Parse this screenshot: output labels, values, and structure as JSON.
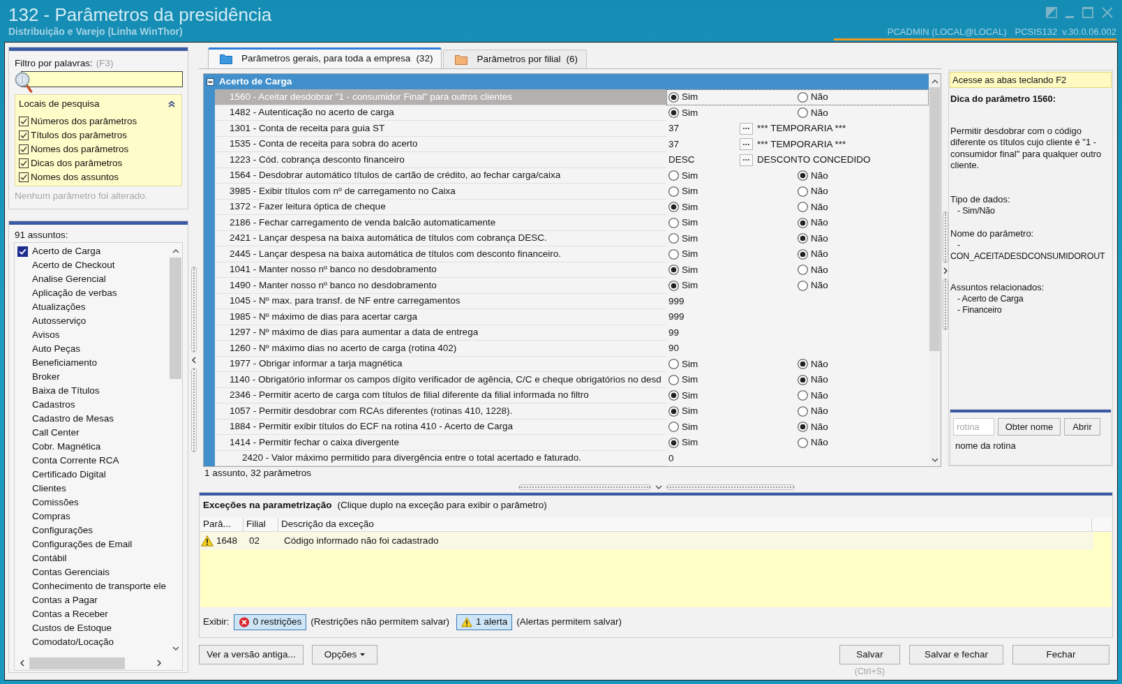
{
  "window": {
    "title": "132 - Parâmetros da presidência",
    "subtitle": "Distribuição e Varejo (Linha WinThor)",
    "session": "PCADMIN (LOCAL@LOCAL)",
    "routine": "PCSIS132",
    "version": "v.30.0.06.002"
  },
  "filter": {
    "label": "Filtro por palavras:",
    "shortcut": "(F3)"
  },
  "search_locations": {
    "title": "Locais de pesquisa",
    "expanded": true,
    "options": [
      {
        "label": "Números dos parâmetros",
        "checked": true
      },
      {
        "label": "Títulos dos parâmetros",
        "checked": true
      },
      {
        "label": "Nomes dos parâmetros",
        "checked": true
      },
      {
        "label": "Dicas dos parâmetros",
        "checked": true
      },
      {
        "label": "Nomes dos assuntos",
        "checked": true
      }
    ]
  },
  "change_status": "Nenhum parâmetro foi alterado.",
  "subjects": {
    "count": "91 assuntos:",
    "items": [
      {
        "label": "Acerto de Carga",
        "checked": true
      },
      {
        "label": "Acerto de Checkout",
        "checked": false
      },
      {
        "label": "Analise Gerencial",
        "checked": false
      },
      {
        "label": "Aplicação de verbas",
        "checked": false
      },
      {
        "label": "Atualizações",
        "checked": false
      },
      {
        "label": "Autosserviço",
        "checked": false
      },
      {
        "label": "Avisos",
        "checked": false
      },
      {
        "label": "Auto Peças",
        "checked": false
      },
      {
        "label": "Beneficiamento",
        "checked": false
      },
      {
        "label": "Broker",
        "checked": false
      },
      {
        "label": "Baixa de Títulos",
        "checked": false
      },
      {
        "label": "Cadastros",
        "checked": false
      },
      {
        "label": "Cadastro de Mesas",
        "checked": false
      },
      {
        "label": "Call Center",
        "checked": false
      },
      {
        "label": "Cobr. Magnética",
        "checked": false
      },
      {
        "label": "Conta Corrente RCA",
        "checked": false
      },
      {
        "label": "Certificado Digital",
        "checked": false
      },
      {
        "label": "Clientes",
        "checked": false
      },
      {
        "label": "Comissões",
        "checked": false
      },
      {
        "label": "Compras",
        "checked": false
      },
      {
        "label": "Configurações",
        "checked": false
      },
      {
        "label": "Configurações de Email",
        "checked": false
      },
      {
        "label": "Contábil",
        "checked": false
      },
      {
        "label": "Contas Gerenciais",
        "checked": false
      },
      {
        "label": "Conhecimento de transporte ele",
        "checked": false
      },
      {
        "label": "Contas a Pagar",
        "checked": false
      },
      {
        "label": "Contas a Receber",
        "checked": false
      },
      {
        "label": "Custos de Estoque",
        "checked": false
      },
      {
        "label": "Comodato/Locação",
        "checked": false
      }
    ]
  },
  "tabs": [
    {
      "label": "Parâmetros gerais, para toda a empresa",
      "count": "(32)",
      "kind": "company",
      "selected": true
    },
    {
      "label": "Parâmetros por filial",
      "count": "(6)",
      "kind": "branch",
      "selected": false
    }
  ],
  "grid": {
    "group": {
      "title": "Acerto de Carga",
      "expanded": true
    },
    "rows": [
      {
        "label": "1560 - Aceitar desdobrar \"1 - consumidor Final\" para outros clientes",
        "kind": "yes_no",
        "selected": true,
        "options": [
          {
            "label": "Sim",
            "selected": true
          },
          {
            "label": "Não",
            "selected": false
          }
        ]
      },
      {
        "label": "1482 - Autenticação no acerto de carga",
        "kind": "yes_no",
        "selected": false,
        "options": [
          {
            "label": "Sim",
            "selected": true
          },
          {
            "label": "Não",
            "selected": false
          }
        ]
      },
      {
        "label": "1301 - Conta de receita para guia ST",
        "kind": "lookup",
        "selected": false,
        "value": "37",
        "description": "*** TEMPORARIA ***"
      },
      {
        "label": "1535 - Conta de receita para sobra do acerto",
        "kind": "lookup",
        "selected": false,
        "value": "37",
        "description": "*** TEMPORARIA ***"
      },
      {
        "label": "1223 - Cód. cobrança desconto financeiro",
        "kind": "lookup",
        "selected": false,
        "value": "DESC",
        "description": "DESCONTO CONCEDIDO"
      },
      {
        "label": "1564 - Desdobrar automático títulos de cartão de crédito, ao fechar carga/caixa",
        "kind": "yes_no",
        "selected": false,
        "options": [
          {
            "label": "Sim",
            "selected": false
          },
          {
            "label": "Não",
            "selected": true
          }
        ]
      },
      {
        "label": "3985 - Exibir títulos com nº de carregamento no Caixa",
        "kind": "yes_no",
        "selected": false,
        "options": [
          {
            "label": "Sim",
            "selected": false
          },
          {
            "label": "Não",
            "selected": false
          }
        ]
      },
      {
        "label": "1372 - Fazer leitura óptica de cheque",
        "kind": "yes_no",
        "selected": false,
        "options": [
          {
            "label": "Sim",
            "selected": true
          },
          {
            "label": "Não",
            "selected": false
          }
        ]
      },
      {
        "label": "2186 - Fechar carregamento de venda balcão automaticamente",
        "kind": "yes_no",
        "selected": false,
        "options": [
          {
            "label": "Sim",
            "selected": false
          },
          {
            "label": "Não",
            "selected": true
          }
        ]
      },
      {
        "label": "2421 - Lançar despesa na baixa automática de títulos com cobrança DESC.",
        "kind": "yes_no",
        "selected": false,
        "options": [
          {
            "label": "Sim",
            "selected": false
          },
          {
            "label": "Não",
            "selected": true
          }
        ]
      },
      {
        "label": "2445 - Lançar despesa na baixa automática de títulos com desconto financeiro.",
        "kind": "yes_no",
        "selected": false,
        "options": [
          {
            "label": "Sim",
            "selected": false
          },
          {
            "label": "Não",
            "selected": true
          }
        ]
      },
      {
        "label": "1041 - Manter nosso nº banco no desdobramento",
        "kind": "yes_no",
        "selected": false,
        "options": [
          {
            "label": "Sim",
            "selected": true
          },
          {
            "label": "Não",
            "selected": false
          }
        ]
      },
      {
        "label": "1490 - Manter nosso nº banco no desdobramento",
        "kind": "yes_no",
        "selected": false,
        "options": [
          {
            "label": "Sim",
            "selected": true
          },
          {
            "label": "Não",
            "selected": false
          }
        ]
      },
      {
        "label": "1045 - Nº max. para transf. de NF entre carregamentos",
        "kind": "number",
        "selected": false,
        "value": "999"
      },
      {
        "label": "1985 - Nº máximo de dias para acertar carga",
        "kind": "number",
        "selected": false,
        "value": "999"
      },
      {
        "label": "1297 - Nº máximo de dias para aumentar a data de entrega",
        "kind": "number",
        "selected": false,
        "value": "99"
      },
      {
        "label": "1260 - Nº máximo dias no acerto de carga (rotina 402)",
        "kind": "number",
        "selected": false,
        "value": "90"
      },
      {
        "label": "1977 - Obrigar informar a tarja magnética",
        "kind": "yes_no",
        "selected": false,
        "options": [
          {
            "label": "Sim",
            "selected": false
          },
          {
            "label": "Não",
            "selected": true
          }
        ]
      },
      {
        "label": "1140 - Obrigatório informar os campos dígito verificador de agência, C/C e cheque obrigatórios no desd",
        "kind": "yes_no",
        "selected": false,
        "options": [
          {
            "label": "Sim",
            "selected": false
          },
          {
            "label": "Não",
            "selected": true
          }
        ]
      },
      {
        "label": "2346 - Permitir acerto de carga com títulos de filial diferente da filial informada no filtro",
        "kind": "yes_no",
        "selected": false,
        "options": [
          {
            "label": "Sim",
            "selected": true
          },
          {
            "label": "Não",
            "selected": false
          }
        ]
      },
      {
        "label": "1057 - Permitir desdobrar com RCAs diferentes (rotinas 410, 1228).",
        "kind": "yes_no",
        "selected": false,
        "options": [
          {
            "label": "Sim",
            "selected": true
          },
          {
            "label": "Não",
            "selected": false
          }
        ]
      },
      {
        "label": "1884 - Permitir exibir títulos do ECF na rotina 410 - Acerto de Carga",
        "kind": "yes_no",
        "selected": false,
        "options": [
          {
            "label": "Sim",
            "selected": false
          },
          {
            "label": "Não",
            "selected": true
          }
        ]
      },
      {
        "label": "1414 - Permitir fechar o caixa divergente",
        "kind": "yes_no",
        "selected": false,
        "options": [
          {
            "label": "Sim",
            "selected": true
          },
          {
            "label": "Não",
            "selected": false
          }
        ],
        "children": [
          {
            "label": "2420 - Valor máximo permitido para divergência entre o total acertado e faturado.",
            "kind": "number",
            "selected": false,
            "value": "0"
          }
        ]
      }
    ],
    "summary": "1 assunto, 32 parâmetros"
  },
  "hint_panel": {
    "notice": "Acesse as abas teclando F2",
    "title": "Dica do parâmetro 1560:",
    "description": "Permitir desdobrar com o código diferente os títulos cujo cliente é \"1 - consumidor final\" para qualquer outro cliente.",
    "sections": [
      {
        "heading": "Tipo de dados:",
        "lines": [
          "- Sim/Não"
        ]
      },
      {
        "heading": "Nome do parâmetro:",
        "lines": [
          "- CON_ACEITADESDCONSUMIDOROUT"
        ]
      },
      {
        "heading": "Assuntos relacionados:",
        "lines": [
          "- Acerto de Carga",
          "- Financeiro"
        ]
      }
    ]
  },
  "routine_lookup": {
    "placeholder": "rotina",
    "buttons": [
      "Obter nome",
      "Abrir"
    ],
    "result": "nome da rotina"
  },
  "exceptions": {
    "title": "Exceções na parametrização",
    "hint": "(Clique duplo na exceção para exibir o parâmetro)",
    "columns": [
      "Parâ...",
      "Filial",
      "Descrição da exceção"
    ],
    "rows": [
      {
        "kind": "alert",
        "selected": true,
        "cells": [
          "1648",
          "02",
          "Código informado não foi cadastrado"
        ]
      }
    ],
    "filter_label": "Exibir:",
    "filters": [
      {
        "kind": "restriction",
        "label": "0 restrições",
        "on": true,
        "note": "(Restrições não permitem salvar)"
      },
      {
        "kind": "alert",
        "label": "1 alerta",
        "on": true,
        "note": "(Alertas permitem salvar)"
      }
    ]
  },
  "footer": {
    "left_buttons": [
      {
        "label": "Ver a versão antiga...",
        "kind": "button"
      },
      {
        "label": "Opções",
        "kind": "dropdown"
      }
    ],
    "right_buttons": [
      {
        "label": "Salvar",
        "shortcut": "(Ctrl+S)"
      },
      {
        "label": "Salvar e fechar"
      },
      {
        "label": "Fechar"
      }
    ]
  }
}
